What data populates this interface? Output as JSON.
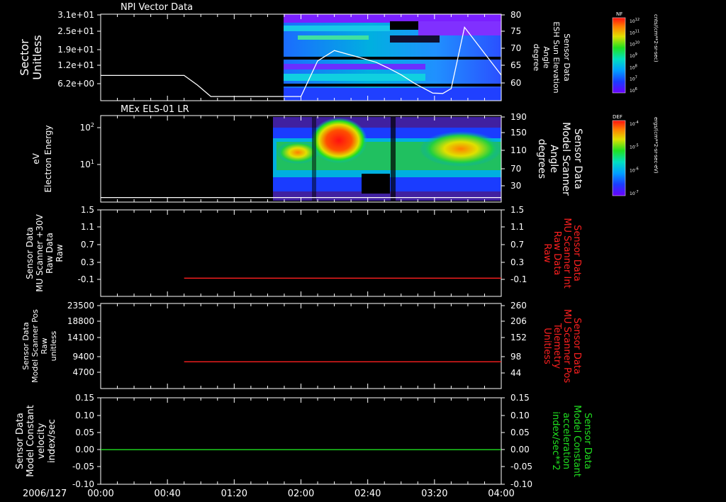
{
  "date_label": "2006/127",
  "time_ticks": [
    "00:00",
    "00:40",
    "01:20",
    "02:00",
    "02:40",
    "03:20",
    "04:00"
  ],
  "colors": {
    "white": "#ffffff",
    "red": "#ff2020",
    "green": "#20e020",
    "background": "#000000"
  },
  "chart_data": [
    {
      "id": "panel1",
      "type": "heatmap",
      "title": "NPI Vector Data",
      "left_label": [
        "Sector",
        "Unitless"
      ],
      "left_ticks": [
        "3.1e+01",
        "2.5e+01",
        "1.9e+01",
        "1.2e+01",
        "6.2e+00"
      ],
      "right_label": [
        "Sensor Data",
        "ESH Sun Elevation",
        "Angle",
        "degree"
      ],
      "right_ticks": [
        "80",
        "75",
        "70",
        "65",
        "60"
      ],
      "right_ylim": [
        55,
        80
      ],
      "line_series": {
        "name": "ESH Sun Elevation Angle",
        "color": "#ffffff",
        "x_min": [
          0,
          50,
          58,
          66,
          120,
          130,
          140,
          155,
          165,
          172,
          180,
          188,
          199,
          205,
          210,
          218,
          240
        ],
        "y": [
          62.3,
          62.3,
          59.5,
          56.2,
          56.2,
          66.5,
          69.5,
          67.5,
          66.1,
          64.5,
          62.5,
          60.0,
          57.2,
          57.1,
          58.5,
          76.2,
          62.4
        ]
      },
      "data_start_min": 120,
      "colorbar": {
        "label": "NF",
        "units": "cnts/(cm**2-sr-sec)",
        "ticks": [
          "10^12",
          "10^11",
          "10^10",
          "10^9",
          "10^8",
          "10^7",
          "10^6"
        ]
      }
    },
    {
      "id": "panel2",
      "type": "heatmap",
      "title": "MEx ELS-01 LR",
      "left_label": [
        "Electron Energy",
        "eV"
      ],
      "left_ticks": [
        "10^2",
        "10^1"
      ],
      "right_label": [
        "Sensor Data",
        "Model Scanner",
        "Angle",
        "degrees"
      ],
      "right_ticks": [
        "190",
        "150",
        "110",
        "70",
        "30"
      ],
      "right_ylim": [
        0,
        190
      ],
      "line_series": {
        "name": "Model Scanner Angle",
        "color": "#ffffff",
        "x_min": [
          0,
          240
        ],
        "y": [
          10,
          10
        ]
      },
      "data_start_min": 113,
      "colorbar": {
        "label": "DEF",
        "units": "ergs/(cm**2-sr-sec-eV)",
        "ticks": [
          "10^-4",
          "10^-5",
          "10^-6",
          "10^-7"
        ]
      }
    },
    {
      "id": "panel3",
      "type": "line",
      "left_label": [
        "Sensor Data",
        "MU Scanner +30V",
        "Raw Data",
        "Raw"
      ],
      "left_ticks": [
        "1.5",
        "1.1",
        "0.7",
        "0.3",
        "-0.1"
      ],
      "right_label": [
        "Sensor Data",
        "MU Scanner Int",
        "Raw Data",
        "Raw"
      ],
      "right_ticks": [
        "1.5",
        "1.1",
        "0.7",
        "0.3",
        "-0.1"
      ],
      "ylim": [
        -0.4,
        1.5
      ],
      "series": [
        {
          "name": "MU Scanner Int Raw Data",
          "color": "#ff2020",
          "x_min": [
            50,
            240
          ],
          "y": [
            0.0,
            0.0
          ]
        }
      ]
    },
    {
      "id": "panel4",
      "type": "line",
      "left_label": [
        "Sensor Data",
        "Model Scanner Pos",
        "Raw",
        "unitless"
      ],
      "left_ticks": [
        "23500",
        "18800",
        "14100",
        "9400",
        "4700"
      ],
      "right_label": [
        "Sensor Data",
        "MU Scanner Pos",
        "Telemetry",
        "Unitless"
      ],
      "right_ticks": [
        "260",
        "206",
        "152",
        "98",
        "44"
      ],
      "ylim": [
        0,
        23500
      ],
      "series": [
        {
          "name": "MU Scanner Pos Telemetry",
          "color": "#ff2020",
          "x_min": [
            50,
            240
          ],
          "y": [
            7400,
            7400
          ]
        }
      ]
    },
    {
      "id": "panel5",
      "type": "line",
      "left_label": [
        "Sensor Data",
        "Model Constant",
        "velocity",
        "index/sec"
      ],
      "left_ticks": [
        "0.15",
        "0.10",
        "0.05",
        "0.00",
        "-0.05",
        "-0.10"
      ],
      "right_label": [
        "Sensor Data",
        "Model Constant",
        "acceleration",
        "index/sec**2"
      ],
      "right_ticks": [
        "0.15",
        "0.10",
        "0.05",
        "0.00",
        "-0.05",
        "-0.10"
      ],
      "ylim": [
        -0.1,
        0.15
      ],
      "series": [
        {
          "name": "Model Constant acceleration",
          "color": "#20e020",
          "x_min": [
            0,
            240
          ],
          "y": [
            0.0,
            0.0
          ]
        }
      ]
    }
  ]
}
